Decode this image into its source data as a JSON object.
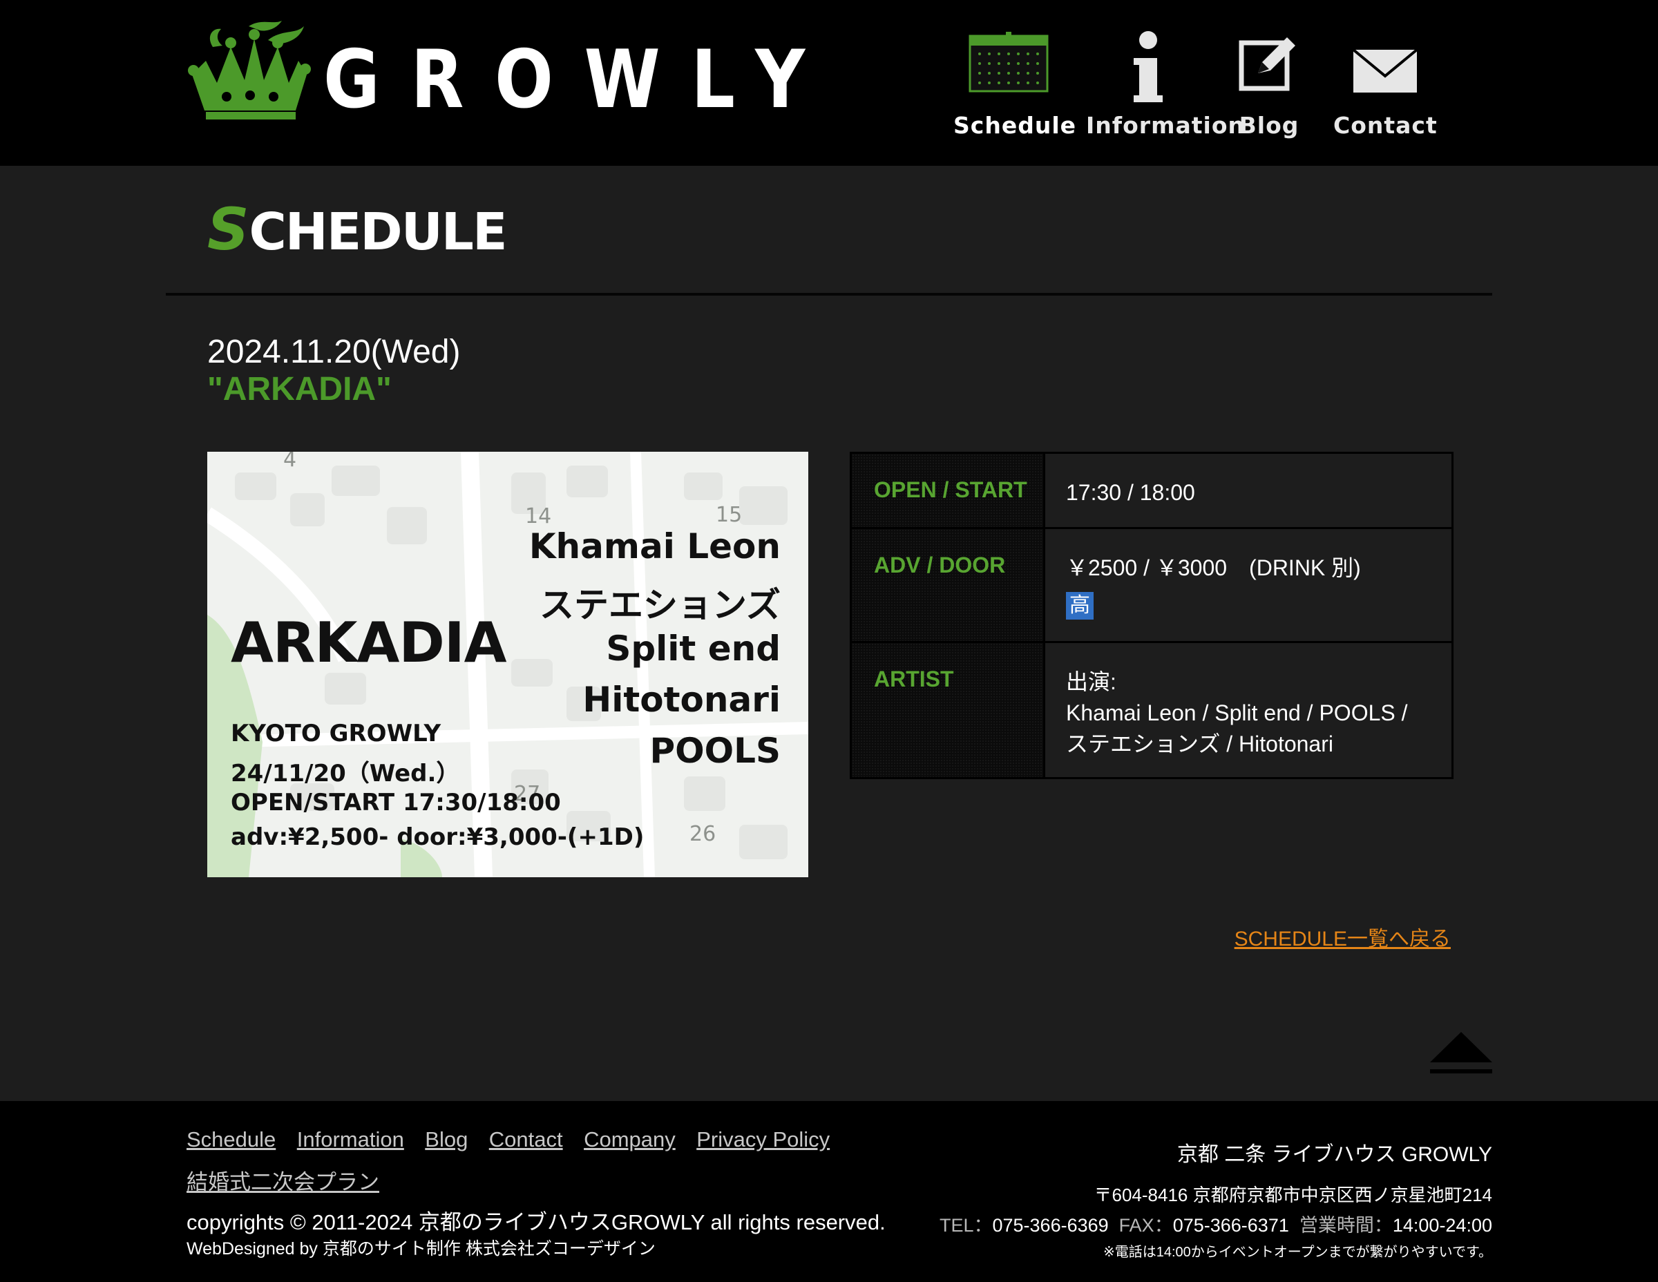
{
  "header": {
    "logo_text": "GROWLY",
    "nav": [
      {
        "label": "Schedule",
        "icon": "calendar-icon"
      },
      {
        "label": "Information",
        "icon": "info-icon"
      },
      {
        "label": "Blog",
        "icon": "edit-icon"
      },
      {
        "label": "Contact",
        "icon": "mail-icon"
      }
    ]
  },
  "main": {
    "section_title_first": "S",
    "section_title_rest": "CHEDULE",
    "event_date": "2024.11.20(Wed)",
    "event_title": "\"ARKADIA\"",
    "flyer": {
      "title": "ARKADIA",
      "artists": [
        "Khamai Leon",
        "ステエションズ",
        "Split end",
        "Hitotonari",
        "POOLS"
      ],
      "venue": "KYOTO GROWLY",
      "date": "24/11/20（Wed.）",
      "open_start": "OPEN/START 17:30/18:00",
      "price": "adv:¥2,500- door:¥3,000-(+1D)",
      "map_numbers": [
        "4",
        "14",
        "15",
        "27",
        "26"
      ]
    },
    "info": {
      "open_label": "OPEN / START",
      "open_value": "17:30 / 18:00",
      "adv_label": "ADV / DOOR",
      "adv_value": "￥2500 / ￥3000　(DRINK 別)",
      "adv_badge": "高",
      "artist_label": "ARTIST",
      "artist_intro": "出演:",
      "artist_line1": "Khamai Leon / Split end / POOLS /",
      "artist_line2": "ステエションズ / Hitotonari"
    },
    "back_link": "SCHEDULE一覧へ戻る"
  },
  "footer": {
    "nav": [
      "Schedule",
      "Information",
      "Blog",
      "Contact",
      "Company",
      "Privacy Policy",
      "結婚式二次会プラン"
    ],
    "copyright": "copyrights © 2011-2024 京都のライブハウスGROWLY all rights reserved.",
    "webdesign": "WebDesigned by 京都のサイト制作 株式会社ズコーデザイン",
    "venue_name": "京都 二条 ライブハウス GROWLY",
    "address": "〒604-8416 京都府京都市中京区西ノ京星池町214",
    "tel_label": "TEL：",
    "tel": "075-366-6369",
    "fax_label": "FAX：",
    "fax": "075-366-6371",
    "hours_label": "営業時間：",
    "hours": "14:00-24:00",
    "note": "※電話は14:00からイベントオープンまでが繋がりやすいです。"
  },
  "colors": {
    "accent_green": "#56a02a",
    "link_orange": "#e58517",
    "background": "#1d1d1d",
    "header_bg": "#000000"
  }
}
